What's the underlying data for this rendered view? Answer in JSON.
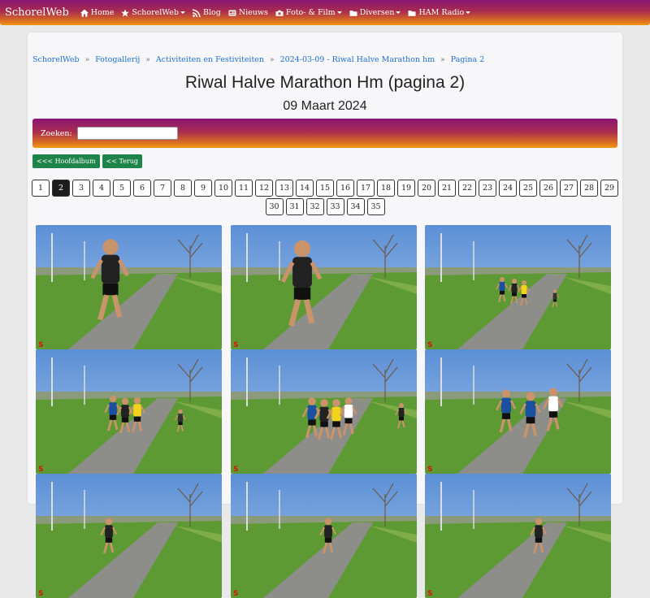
{
  "nav": {
    "brand": "SchorelWeb",
    "items": [
      {
        "label": "Home",
        "icon": "home-icon",
        "dropdown": false
      },
      {
        "label": "SchorelWeb",
        "icon": "star-icon",
        "dropdown": true
      },
      {
        "label": "Blog",
        "icon": "rss-icon",
        "dropdown": false
      },
      {
        "label": "Nieuws",
        "icon": "newspaper-icon",
        "dropdown": false
      },
      {
        "label": "Foto- & Film",
        "icon": "camera-icon",
        "dropdown": true
      },
      {
        "label": "Diversen",
        "icon": "folder-icon",
        "dropdown": true
      },
      {
        "label": "HAM Radio",
        "icon": "folder-icon",
        "dropdown": true
      }
    ]
  },
  "breadcrumb": [
    "SchorelWeb",
    "Fotogallerij",
    "Activiteiten en Festiviteiten",
    "2024-03-09 - Riwal Halve Marathon hm",
    "Pagina 2"
  ],
  "title": "Riwal Halve Marathon Hm (pagina 2)",
  "subtitle": "09 Maart 2024",
  "search": {
    "label": "Zoeken:",
    "value": ""
  },
  "buttons": {
    "main_album": "<<< Hoofdalbum",
    "back": "<< Terug"
  },
  "pagination": {
    "current": "2",
    "row1": [
      "1",
      "2",
      "3",
      "4",
      "5",
      "6",
      "7",
      "8",
      "9",
      "10",
      "11",
      "12",
      "13",
      "14",
      "15",
      "16",
      "17",
      "18",
      "19",
      "20",
      "21",
      "22",
      "23",
      "24",
      "25",
      "26",
      "27",
      "28",
      "29"
    ],
    "row2": [
      "30",
      "31",
      "32",
      "33",
      "34",
      "35"
    ]
  },
  "colors": {
    "accent_start": "#8a1577",
    "accent_end": "#f39712",
    "button_green": "#1e8449",
    "link": "#1f6fd6"
  },
  "photos": [
    {
      "name": "photo-1"
    },
    {
      "name": "photo-2"
    },
    {
      "name": "photo-3"
    },
    {
      "name": "photo-4"
    },
    {
      "name": "photo-5"
    },
    {
      "name": "photo-6"
    },
    {
      "name": "photo-7"
    },
    {
      "name": "photo-8"
    },
    {
      "name": "photo-9"
    }
  ]
}
